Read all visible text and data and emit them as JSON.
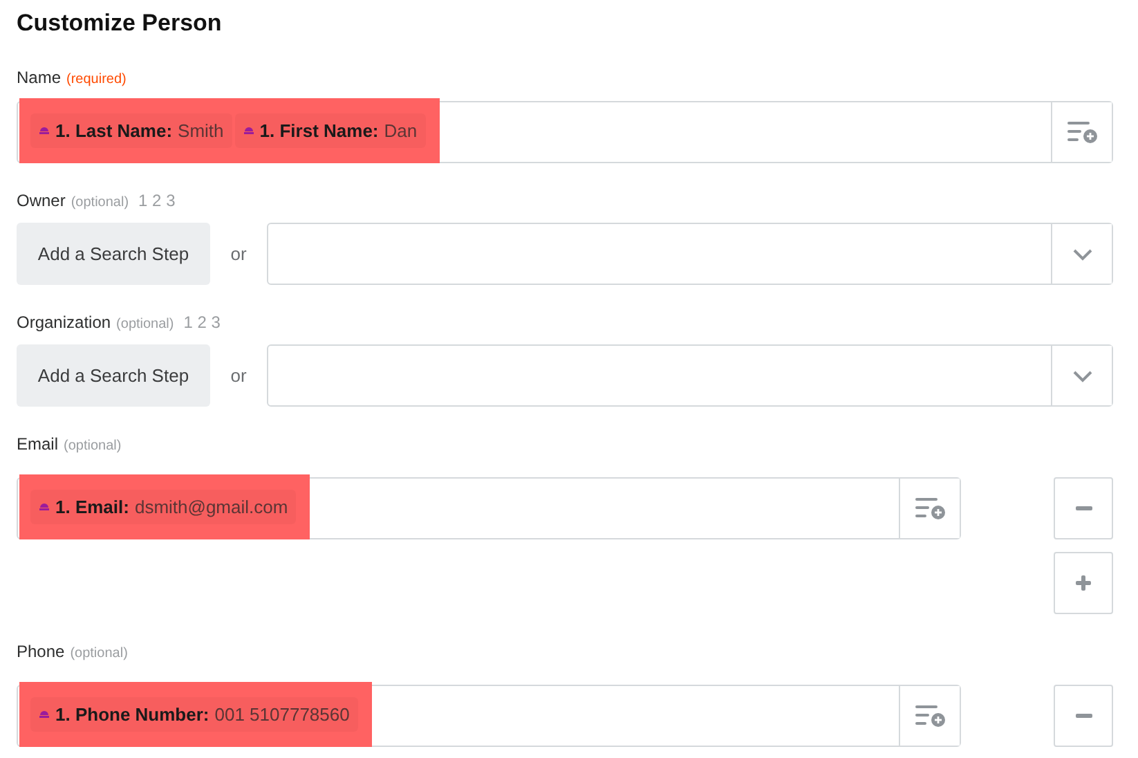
{
  "title": "Customize Person",
  "fields": [
    {
      "kind": "tokens",
      "label": "Name",
      "qualifier": "(required)",
      "required": true,
      "highlighted": true,
      "removable": false,
      "addable": false,
      "tokens": [
        {
          "label": "1. Last Name:",
          "value": "Smith"
        },
        {
          "label": "1. First Name:",
          "value": "Dan"
        }
      ]
    },
    {
      "kind": "search_select",
      "label": "Owner",
      "qualifier": "(optional)",
      "required": false,
      "steps": "1 2 3",
      "button": "Add a Search Step",
      "separator": "or"
    },
    {
      "kind": "search_select",
      "label": "Organization",
      "qualifier": "(optional)",
      "required": false,
      "steps": "1 2 3",
      "button": "Add a Search Step",
      "separator": "or"
    },
    {
      "kind": "tokens",
      "label": "Email",
      "qualifier": "(optional)",
      "required": false,
      "highlighted": true,
      "removable": true,
      "addable": true,
      "tokens": [
        {
          "label": "1. Email:",
          "value": "dsmith@gmail.com"
        }
      ]
    },
    {
      "kind": "tokens",
      "label": "Phone",
      "qualifier": "(optional)",
      "required": false,
      "highlighted": true,
      "removable": true,
      "addable": false,
      "tokens": [
        {
          "label": "1. Phone Number:",
          "value": "001 5107778560"
        }
      ]
    }
  ]
}
